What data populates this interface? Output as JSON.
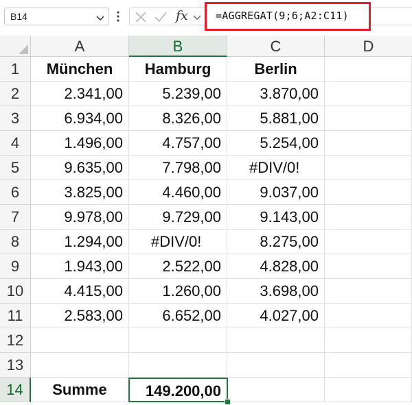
{
  "name_box": {
    "value": "B14"
  },
  "formula_bar": {
    "formula": "=AGGREGAT(9;6;A2:C11)",
    "fx_label": "fx"
  },
  "columns": [
    "A",
    "B",
    "C",
    "D"
  ],
  "rows": [
    "1",
    "2",
    "3",
    "4",
    "5",
    "6",
    "7",
    "8",
    "9",
    "10",
    "11",
    "12",
    "13",
    "14"
  ],
  "cells": {
    "A1": "München",
    "B1": "Hamburg",
    "C1": "Berlin",
    "A2": "2.341,00",
    "B2": "5.239,00",
    "C2": "3.870,00",
    "A3": "6.934,00",
    "B3": "8.326,00",
    "C3": "5.881,00",
    "A4": "1.496,00",
    "B4": "4.757,00",
    "C4": "5.254,00",
    "A5": "9.635,00",
    "B5": "7.798,00",
    "C5": "#DIV/0!",
    "A6": "3.825,00",
    "B6": "4.460,00",
    "C6": "9.037,00",
    "A7": "9.978,00",
    "B7": "9.729,00",
    "C7": "9.143,00",
    "A8": "1.294,00",
    "B8": "#DIV/0!",
    "C8": "8.275,00",
    "A9": "1.943,00",
    "B9": "2.522,00",
    "C9": "4.828,00",
    "A10": "4.415,00",
    "B10": "1.260,00",
    "C10": "3.698,00",
    "A11": "2.583,00",
    "B11": "6.652,00",
    "C11": "4.027,00",
    "A14": "Summe",
    "B14": "149.200,00"
  },
  "selection": {
    "active_cell": "B14",
    "accent_color": "#1f7a3c",
    "highlight_color": "#e21f26"
  }
}
